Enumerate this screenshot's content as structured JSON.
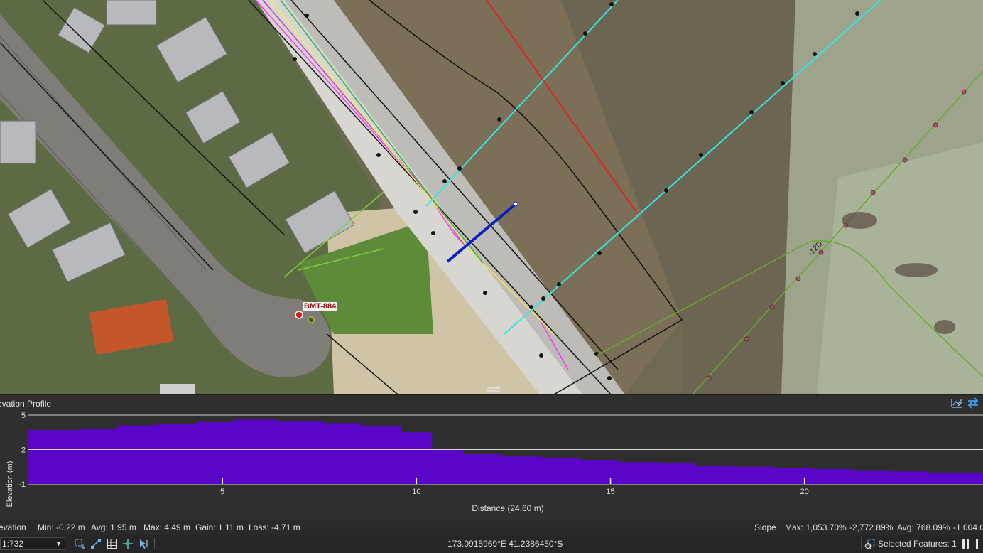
{
  "map": {
    "label_bmt": "BMT-884",
    "label_contour": "-12D"
  },
  "profile": {
    "title": "evation Profile",
    "y_axis_label": "Elevation (m)",
    "x_axis_label": "Distance (24.60 m)",
    "y_ticks": [
      "5",
      "2",
      "-1"
    ],
    "x_ticks": [
      "5",
      "10",
      "15",
      "20"
    ],
    "fill_color": "#5a06c8"
  },
  "chart_data": {
    "type": "area",
    "xlabel": "Distance (24.60 m)",
    "ylabel": "Elevation (m)",
    "xlim": [
      0,
      24.6
    ],
    "ylim": [
      -1,
      5
    ],
    "grid": true,
    "x": [
      0,
      1.3,
      2.3,
      3.3,
      4.3,
      5.3,
      6.4,
      7.6,
      8.6,
      9.6,
      10.4,
      11.2,
      12.2,
      13.2,
      14.2,
      15.2,
      16.2,
      17.2,
      18.2,
      19.2,
      20.2,
      21.2,
      22.2,
      23.2,
      24.6
    ],
    "series": [
      {
        "values": [
          3.7,
          3.8,
          4.1,
          4.2,
          4.4,
          4.6,
          4.49,
          4.3,
          4.0,
          3.5,
          2.0,
          1.6,
          1.4,
          1.3,
          1.1,
          0.9,
          0.8,
          0.6,
          0.5,
          0.4,
          0.3,
          0.2,
          0.1,
          0.0,
          -0.22
        ]
      }
    ]
  },
  "stats": {
    "elevation_label": "evation",
    "min": "Min: -0.22 m",
    "avg": "Avg: 1.95 m",
    "max": "Max: 4.49 m",
    "gain": "Gain: 1.11 m",
    "loss": "Loss: -4.71 m",
    "slope_label": "Slope",
    "slope_max": "Max: 1,053.70%",
    "slope_min": "-2,772.89%",
    "slope_avg": "Avg: 768.09%",
    "slope_tail": "-1,004.0("
  },
  "statusbar": {
    "scale": "1:732",
    "coordinates": "173.0915969°E 41.2386450°S",
    "selected_features": "Selected Features: 1"
  },
  "icons": {
    "profile_chart": "profile-chart-icon",
    "swap": "swap-direction-icon",
    "grid": "grid-icon",
    "snap": "snapping-icon",
    "select": "select-features-icon"
  }
}
